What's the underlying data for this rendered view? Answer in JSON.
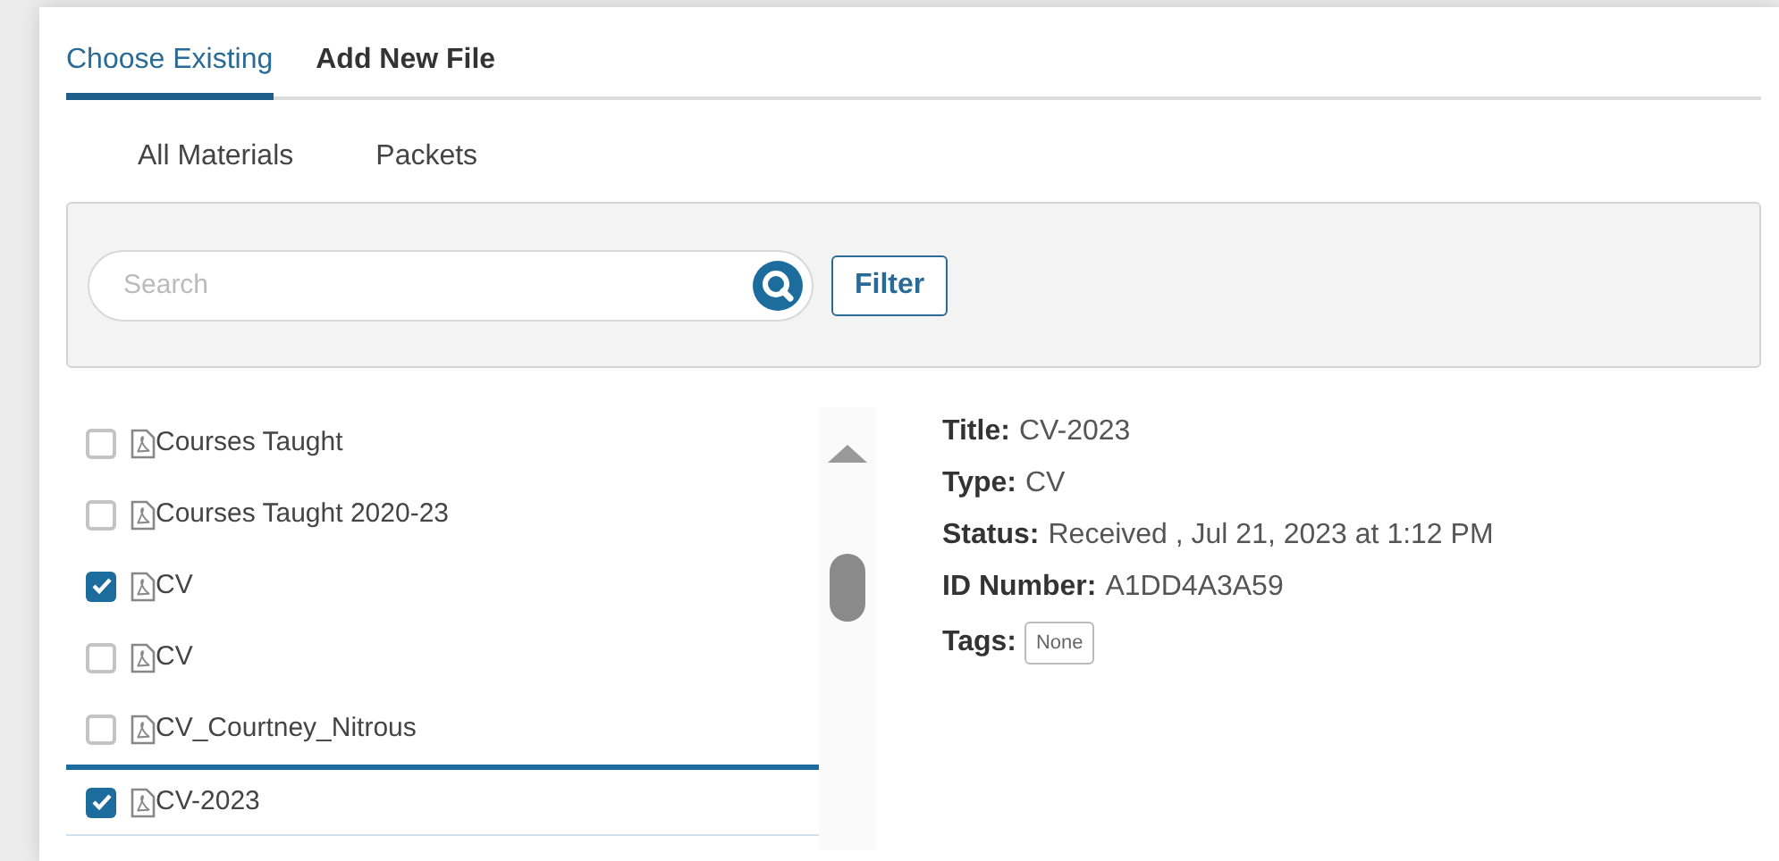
{
  "tabs": [
    {
      "label": "Choose Existing",
      "selected": true
    },
    {
      "label": "Add New File",
      "selected": false
    }
  ],
  "subtabs": [
    {
      "label": "All Materials"
    },
    {
      "label": "Packets"
    }
  ],
  "search": {
    "placeholder": "Search"
  },
  "filter_button": "Filter",
  "files": [
    {
      "name": "Courses Taught",
      "checked": false,
      "selected": false
    },
    {
      "name": "Courses Taught 2020-23",
      "checked": false,
      "selected": false
    },
    {
      "name": "CV",
      "checked": true,
      "selected": false
    },
    {
      "name": "CV",
      "checked": false,
      "selected": false
    },
    {
      "name": "CV_Courtney_Nitrous",
      "checked": false,
      "selected": false
    },
    {
      "name": "CV-2023",
      "checked": true,
      "selected": true
    }
  ],
  "details": [
    {
      "label": "Title:",
      "value": "CV-2023"
    },
    {
      "label": "Type:",
      "value": "CV"
    },
    {
      "label": "Status:",
      "value": "Received , Jul 21, 2023 at 1:12 PM"
    },
    {
      "label": "ID Number:",
      "value": "A1DD4A3A59"
    }
  ],
  "tags": {
    "label": "Tags:",
    "badge": "None"
  }
}
